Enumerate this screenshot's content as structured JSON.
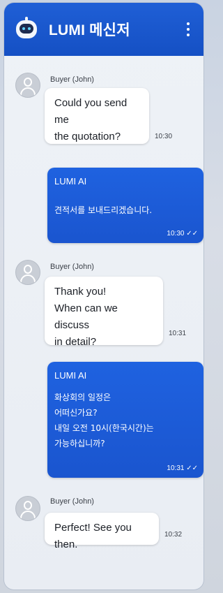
{
  "header": {
    "title": "LUMI 메신저",
    "menu_icon": "more-vertical-icon",
    "bot_icon": "robot-icon"
  },
  "colors": {
    "header_blue": "#1a56cc",
    "out_bubble": "#1c5bd8"
  },
  "messages": [
    {
      "sender": "Buyer (John)",
      "text": "Could you send me\nthe quotation?",
      "time": "10:30"
    },
    {
      "sender": "LUMI AI",
      "text": "견적서를 보내드리겠습니다.",
      "time": "10:30",
      "status": "read-checkmarks"
    },
    {
      "sender": "Buyer (John)",
      "text": "Thank you!\nWhen can we discuss\nin detail?",
      "time": "10:31"
    },
    {
      "sender": "LUMI AI",
      "text": "화상회의 일정은\n어떠신가요?\n내일 오전 10시(한국시간)는\n가능하십니까?",
      "time": "10:31",
      "status": "read-checkmarks"
    },
    {
      "sender": "Buyer (John)",
      "text": "Perfect! See you then.",
      "time": "10:32"
    }
  ]
}
